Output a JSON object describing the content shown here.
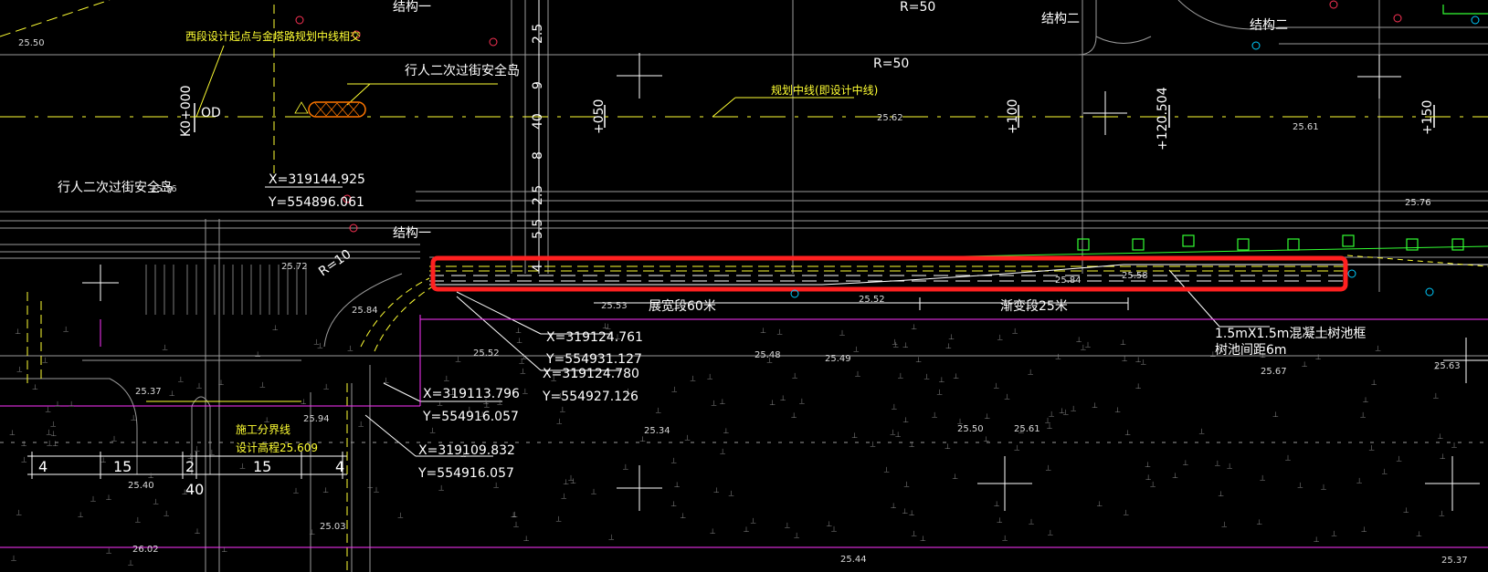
{
  "colors": {
    "background": "#000000",
    "white_line": "#ffffff",
    "gray_line": "#9a9a9a",
    "yellow_line": "#ffff33",
    "magenta_line": "#ff33ff",
    "green_line": "#33ff33",
    "highlight_box": "#ff2020",
    "orange_hatch": "#ff7700",
    "cyan_marker": "#00ccff",
    "red_marker": "#ff3355"
  },
  "annotations": {
    "west_section_note": "西段设计起点与金塔路规划中线相交",
    "pedestrian_island_1": "行人二次过街安全岛",
    "pedestrian_island_2": "行人二次过街安全岛",
    "center_line_note": "规划中线(即设计中线)",
    "radius_1": "R=50",
    "radius_2": "R=50",
    "radius_3": "R=10",
    "station_k0": "K0+000",
    "od_label": "OD",
    "station_050": "+050",
    "station_100": "+100",
    "station_120": "+120.504",
    "station_150": "+150",
    "coord_x1": "X=319144.925",
    "coord_y1": "Y=554896.061",
    "coord_x2": "X=319124.761",
    "coord_y2": "Y=554931.127",
    "coord_x3": "X=319124.780",
    "coord_y3": "Y=554927.126",
    "coord_x4": "X=319113.796",
    "coord_y4": "Y=554916.057",
    "coord_x5": "X=319109.832",
    "coord_y5": "Y=554916.057",
    "widening_section": "展宽段60米",
    "transition_section": "渐变段25米",
    "tree_pit_note_1": "1.5mX1.5m混凝土树池框",
    "tree_pit_note_2": "树池间距6m",
    "construction_boundary": "施工分界线",
    "design_elevation": "设计高程25.609",
    "structure_1": "结构一",
    "structure_2": "结构二",
    "structure_3": "结构一",
    "structure_4": "结构二",
    "dim_40_top": "40",
    "dim_8": "8",
    "dim_9": "9",
    "dim_25_a": "2.5",
    "dim_25_b": "2.5",
    "dim_55": "5.5",
    "dim_4_v": "4",
    "dim_4_a": "4",
    "dim_15_a": "15",
    "dim_2": "2",
    "dim_15_b": "15",
    "dim_4_b": "4",
    "dim_40_bottom": "40",
    "elev_a": "25.50",
    "elev_b": "25.72",
    "elev_c": "25.84",
    "elev_d": "25.53",
    "elev_e": "25.52",
    "elev_f": "25.48",
    "elev_g": "25.49",
    "elev_h": "25.37",
    "elev_i": "25.94",
    "elev_j": "25.40",
    "elev_k": "25.03",
    "elev_l": "26.02",
    "elev_m": "25.44",
    "elev_n": "25.37",
    "elev_o": "25.63",
    "elev_p": "25.67",
    "elev_q": "25.61",
    "elev_r": "25.50",
    "elev_s": "25.34",
    "elev_t": "25.56",
    "elev_u": "25.76",
    "elev_v": "25.52",
    "elev_w": "25.62",
    "elev_x": "25.58",
    "elev_y": "25.84",
    "elev_z": "25.61"
  }
}
